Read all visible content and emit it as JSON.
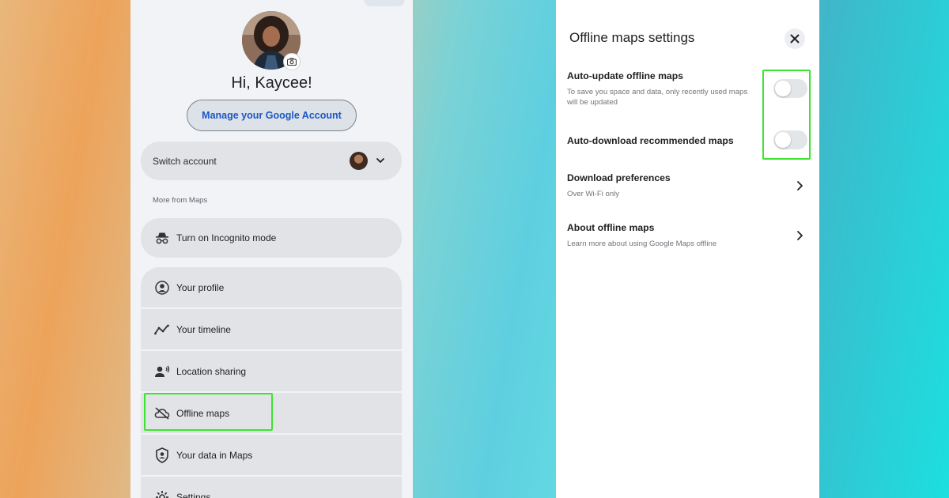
{
  "profile": {
    "greeting": "Hi, Kaycee!",
    "manage_account_label": "Manage your Google Account",
    "switch_account_label": "Switch account"
  },
  "menu": {
    "section_label": "More from Maps",
    "incognito_label": "Turn on Incognito mode",
    "items": [
      {
        "label": "Your profile",
        "icon": "account-circle-icon"
      },
      {
        "label": "Your timeline",
        "icon": "timeline-icon"
      },
      {
        "label": "Location sharing",
        "icon": "location-sharing-icon"
      },
      {
        "label": "Offline maps",
        "icon": "cloud-off-icon"
      },
      {
        "label": "Your data in Maps",
        "icon": "shield-person-icon"
      },
      {
        "label": "Settings",
        "icon": "gear-icon"
      }
    ]
  },
  "settings": {
    "title": "Offline maps settings",
    "items": [
      {
        "title": "Auto-update offline maps",
        "subtitle": "To save you space and data, only recently used maps will be updated",
        "control": "toggle",
        "enabled": false
      },
      {
        "title": "Auto-download recommended maps",
        "subtitle": "",
        "control": "toggle",
        "enabled": false
      },
      {
        "title": "Download preferences",
        "subtitle": "Over Wi-Fi only",
        "control": "chevron"
      },
      {
        "title": "About offline maps",
        "subtitle": "Learn more about using Google Maps offline",
        "control": "chevron"
      }
    ]
  },
  "colors": {
    "highlight": "#3ce42f",
    "link_blue": "#1a57c6",
    "panel_bg": "#f1f3f6",
    "pill_bg": "#e1e3e6"
  }
}
